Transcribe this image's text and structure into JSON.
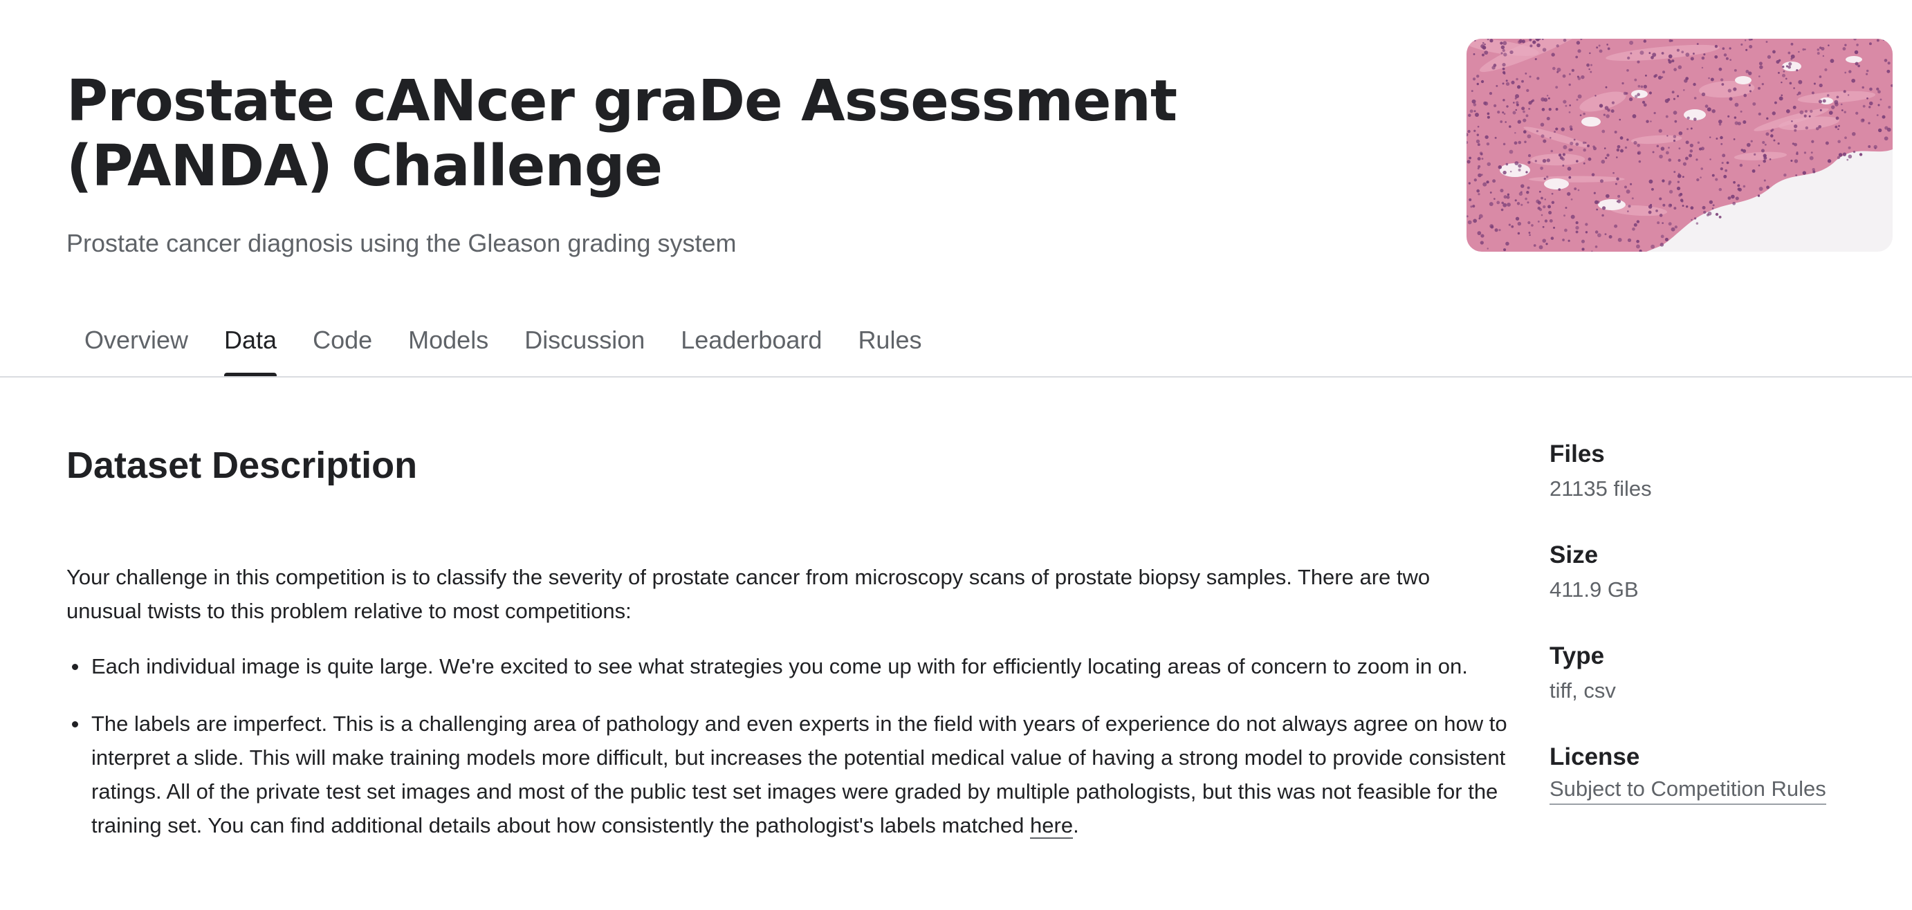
{
  "competition": {
    "title": "Prostate cANcer graDe Assessment (PANDA) Challenge",
    "subtitle": "Prostate cancer diagnosis using the Gleason grading system"
  },
  "tabs": [
    {
      "label": "Overview",
      "active": false
    },
    {
      "label": "Data",
      "active": true
    },
    {
      "label": "Code",
      "active": false
    },
    {
      "label": "Models",
      "active": false
    },
    {
      "label": "Discussion",
      "active": false
    },
    {
      "label": "Leaderboard",
      "active": false
    },
    {
      "label": "Rules",
      "active": false
    }
  ],
  "dataset": {
    "heading": "Dataset Description",
    "intro": "Your challenge in this competition is to classify the severity of prostate cancer from microscopy scans of prostate biopsy samples. There are two unusual twists to this problem relative to most competitions:",
    "bullet1": "Each individual image is quite large. We're excited to see what strategies you come up with for efficiently locating areas of concern to zoom in on.",
    "bullet2_text": "The labels are imperfect. This is a challenging area of pathology and even experts in the field with years of experience do not always agree on how to interpret a slide. This will make training models more difficult, but increases the potential medical value of having a strong model to provide consistent ratings. All of the private test set images and most of the public test set images were graded by multiple pathologists, but this was not feasible for the training set. You can find additional details about how consistently the pathologist's labels matched ",
    "bullet2_link": "here",
    "bullet2_end": "."
  },
  "sidebar": {
    "files_label": "Files",
    "files_value": "21135 files",
    "size_label": "Size",
    "size_value": "411.9 GB",
    "type_label": "Type",
    "type_value": "tiff, csv",
    "license_label": "License",
    "license_value": "Subject to Competition Rules"
  },
  "colors": {
    "text_primary": "#202124",
    "text_secondary": "#5f6368",
    "divider": "#dadce0",
    "tissue_pink": "#d98aa6",
    "tissue_purple": "#7a3f78"
  },
  "hero_image": "histology-tissue-image"
}
